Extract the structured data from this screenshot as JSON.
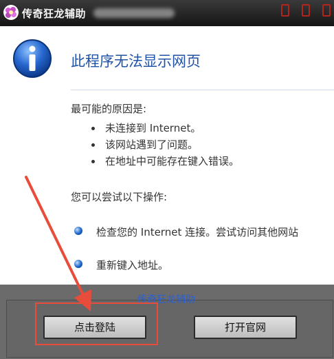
{
  "titlebar": {
    "title": "传奇狂龙辅助"
  },
  "error_page": {
    "heading": "此程序无法显示网页",
    "reasons_title": "最可能的原因是:",
    "reasons": [
      "未连接到 Internet。",
      "该网站遇到了问题。",
      "在地址中可能存在键入错误。"
    ],
    "try_title": "您可以尝试以下操作:",
    "actions": [
      "检查您的 Internet 连接。尝试访问其他网站",
      "重新键入地址。"
    ]
  },
  "footer": {
    "brand_link": "传奇狂龙辅助",
    "login_button": "点击登陆",
    "official_site_button": "打开官网"
  },
  "colors": {
    "heading": "#1f53a8",
    "annotation": "#e84c3b",
    "link": "#2a5fd6"
  }
}
